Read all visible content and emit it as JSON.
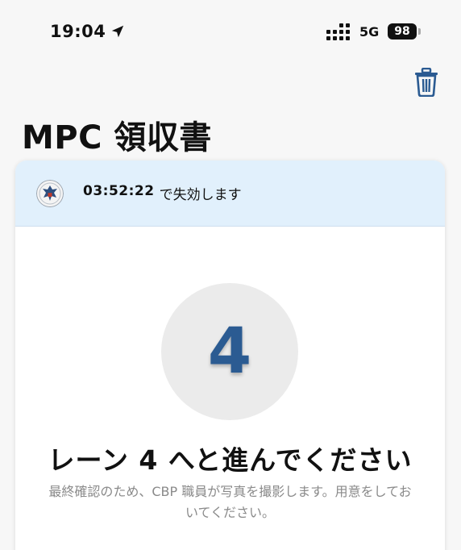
{
  "status_bar": {
    "time": "19:04",
    "network": "5G",
    "battery": "98"
  },
  "icons": {
    "location": "location-arrow-icon",
    "signal": "signal-strength-icon",
    "trash": "trash-icon",
    "seal": "cbp-seal-icon"
  },
  "header": {
    "title": "MPC 領収書"
  },
  "card": {
    "banner": {
      "timer": "03:52:22",
      "expiry_suffix": "で失効します"
    },
    "lane_number": "4",
    "headline": "レーン 4 へと進んでください",
    "instruction": "最終確認のため、CBP 職員が写真を撮影します。用意をしておいてください。"
  },
  "colors": {
    "banner_bg": "#e1f0fc",
    "accent_blue": "#2b5b92",
    "lane_circle": "#ebebeb"
  }
}
